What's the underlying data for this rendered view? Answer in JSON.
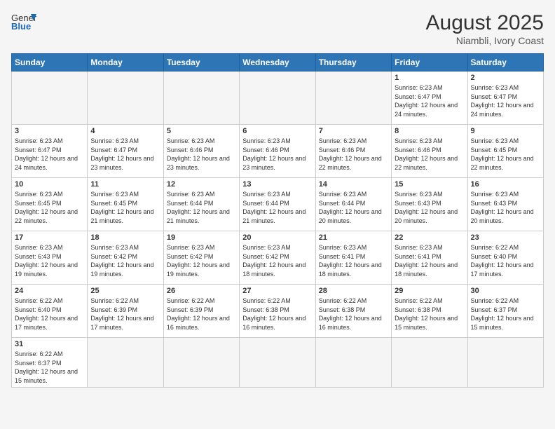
{
  "header": {
    "logo_general": "General",
    "logo_blue": "Blue",
    "month_year": "August 2025",
    "location": "Niambli, Ivory Coast"
  },
  "weekdays": [
    "Sunday",
    "Monday",
    "Tuesday",
    "Wednesday",
    "Thursday",
    "Friday",
    "Saturday"
  ],
  "weeks": [
    [
      {
        "day": "",
        "info": ""
      },
      {
        "day": "",
        "info": ""
      },
      {
        "day": "",
        "info": ""
      },
      {
        "day": "",
        "info": ""
      },
      {
        "day": "",
        "info": ""
      },
      {
        "day": "1",
        "info": "Sunrise: 6:23 AM\nSunset: 6:47 PM\nDaylight: 12 hours and 24 minutes."
      },
      {
        "day": "2",
        "info": "Sunrise: 6:23 AM\nSunset: 6:47 PM\nDaylight: 12 hours and 24 minutes."
      }
    ],
    [
      {
        "day": "3",
        "info": "Sunrise: 6:23 AM\nSunset: 6:47 PM\nDaylight: 12 hours and 24 minutes."
      },
      {
        "day": "4",
        "info": "Sunrise: 6:23 AM\nSunset: 6:47 PM\nDaylight: 12 hours and 23 minutes."
      },
      {
        "day": "5",
        "info": "Sunrise: 6:23 AM\nSunset: 6:46 PM\nDaylight: 12 hours and 23 minutes."
      },
      {
        "day": "6",
        "info": "Sunrise: 6:23 AM\nSunset: 6:46 PM\nDaylight: 12 hours and 23 minutes."
      },
      {
        "day": "7",
        "info": "Sunrise: 6:23 AM\nSunset: 6:46 PM\nDaylight: 12 hours and 22 minutes."
      },
      {
        "day": "8",
        "info": "Sunrise: 6:23 AM\nSunset: 6:46 PM\nDaylight: 12 hours and 22 minutes."
      },
      {
        "day": "9",
        "info": "Sunrise: 6:23 AM\nSunset: 6:45 PM\nDaylight: 12 hours and 22 minutes."
      }
    ],
    [
      {
        "day": "10",
        "info": "Sunrise: 6:23 AM\nSunset: 6:45 PM\nDaylight: 12 hours and 22 minutes."
      },
      {
        "day": "11",
        "info": "Sunrise: 6:23 AM\nSunset: 6:45 PM\nDaylight: 12 hours and 21 minutes."
      },
      {
        "day": "12",
        "info": "Sunrise: 6:23 AM\nSunset: 6:44 PM\nDaylight: 12 hours and 21 minutes."
      },
      {
        "day": "13",
        "info": "Sunrise: 6:23 AM\nSunset: 6:44 PM\nDaylight: 12 hours and 21 minutes."
      },
      {
        "day": "14",
        "info": "Sunrise: 6:23 AM\nSunset: 6:44 PM\nDaylight: 12 hours and 20 minutes."
      },
      {
        "day": "15",
        "info": "Sunrise: 6:23 AM\nSunset: 6:43 PM\nDaylight: 12 hours and 20 minutes."
      },
      {
        "day": "16",
        "info": "Sunrise: 6:23 AM\nSunset: 6:43 PM\nDaylight: 12 hours and 20 minutes."
      }
    ],
    [
      {
        "day": "17",
        "info": "Sunrise: 6:23 AM\nSunset: 6:43 PM\nDaylight: 12 hours and 19 minutes."
      },
      {
        "day": "18",
        "info": "Sunrise: 6:23 AM\nSunset: 6:42 PM\nDaylight: 12 hours and 19 minutes."
      },
      {
        "day": "19",
        "info": "Sunrise: 6:23 AM\nSunset: 6:42 PM\nDaylight: 12 hours and 19 minutes."
      },
      {
        "day": "20",
        "info": "Sunrise: 6:23 AM\nSunset: 6:42 PM\nDaylight: 12 hours and 18 minutes."
      },
      {
        "day": "21",
        "info": "Sunrise: 6:23 AM\nSunset: 6:41 PM\nDaylight: 12 hours and 18 minutes."
      },
      {
        "day": "22",
        "info": "Sunrise: 6:23 AM\nSunset: 6:41 PM\nDaylight: 12 hours and 18 minutes."
      },
      {
        "day": "23",
        "info": "Sunrise: 6:22 AM\nSunset: 6:40 PM\nDaylight: 12 hours and 17 minutes."
      }
    ],
    [
      {
        "day": "24",
        "info": "Sunrise: 6:22 AM\nSunset: 6:40 PM\nDaylight: 12 hours and 17 minutes."
      },
      {
        "day": "25",
        "info": "Sunrise: 6:22 AM\nSunset: 6:39 PM\nDaylight: 12 hours and 17 minutes."
      },
      {
        "day": "26",
        "info": "Sunrise: 6:22 AM\nSunset: 6:39 PM\nDaylight: 12 hours and 16 minutes."
      },
      {
        "day": "27",
        "info": "Sunrise: 6:22 AM\nSunset: 6:38 PM\nDaylight: 12 hours and 16 minutes."
      },
      {
        "day": "28",
        "info": "Sunrise: 6:22 AM\nSunset: 6:38 PM\nDaylight: 12 hours and 16 minutes."
      },
      {
        "day": "29",
        "info": "Sunrise: 6:22 AM\nSunset: 6:38 PM\nDaylight: 12 hours and 15 minutes."
      },
      {
        "day": "30",
        "info": "Sunrise: 6:22 AM\nSunset: 6:37 PM\nDaylight: 12 hours and 15 minutes."
      }
    ],
    [
      {
        "day": "31",
        "info": "Sunrise: 6:22 AM\nSunset: 6:37 PM\nDaylight: 12 hours and 15 minutes."
      },
      {
        "day": "",
        "info": ""
      },
      {
        "day": "",
        "info": ""
      },
      {
        "day": "",
        "info": ""
      },
      {
        "day": "",
        "info": ""
      },
      {
        "day": "",
        "info": ""
      },
      {
        "day": "",
        "info": ""
      }
    ]
  ]
}
